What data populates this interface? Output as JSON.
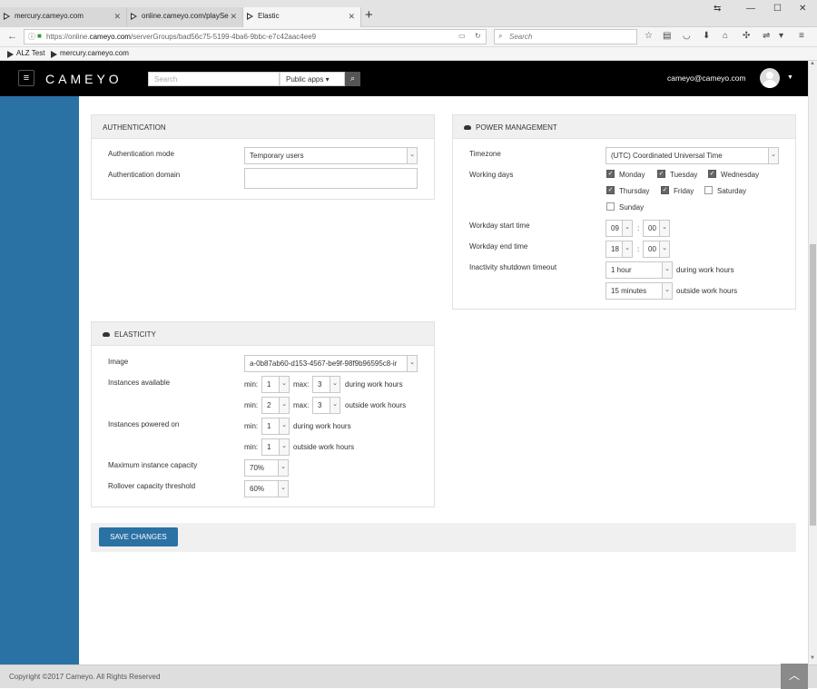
{
  "browser": {
    "tabs": [
      {
        "label": "mercury.cameyo.com",
        "active": false
      },
      {
        "label": "online.cameyo.com/playSe",
        "active": false
      },
      {
        "label": "Elastic",
        "active": true
      }
    ],
    "url_prefix": "https://online.",
    "url_domain": "cameyo.com",
    "url_path": "/serverGroups/bad56c75-5199-4ba6-9bbc-e7c42aac4ee9",
    "search_placeholder": "Search",
    "bookmarks": [
      "ALZ Test",
      "mercury.cameyo.com"
    ]
  },
  "header": {
    "logo": "CAMEYO",
    "search_placeholder": "Search",
    "scope_select": "Public apps",
    "user_email": "cameyo@cameyo.com"
  },
  "authentication": {
    "title": "AUTHENTICATION",
    "mode_label": "Authentication mode",
    "mode_value": "Temporary users",
    "domain_label": "Authentication domain",
    "domain_value": ""
  },
  "power": {
    "title": "POWER MANAGEMENT",
    "timezone_label": "Timezone",
    "timezone_value": "(UTC) Coordinated Universal Time",
    "working_days_label": "Working days",
    "days": [
      {
        "name": "Monday",
        "checked": true
      },
      {
        "name": "Tuesday",
        "checked": true
      },
      {
        "name": "Wednesday",
        "checked": true
      },
      {
        "name": "Thursday",
        "checked": true
      },
      {
        "name": "Friday",
        "checked": true
      },
      {
        "name": "Saturday",
        "checked": false
      },
      {
        "name": "Sunday",
        "checked": false
      }
    ],
    "start_label": "Workday start time",
    "start_hour": "09",
    "start_min": "00",
    "end_label": "Workday end time",
    "end_hour": "18",
    "end_min": "00",
    "time_sep": ":",
    "inactivity_label": "Inactivity shutdown timeout",
    "inactivity_work": "1 hour",
    "inactivity_work_suffix": "during work hours",
    "inactivity_off": "15 minutes",
    "inactivity_off_suffix": "outside work hours"
  },
  "elasticity": {
    "title": "ELASTICITY",
    "image_label": "Image",
    "image_value": "a-0b87ab60-d153-4567-be9f-98f9b96595c8-ir",
    "instances_label": "Instances available",
    "min_label": "min:",
    "max_label": "max:",
    "avail_work_min": "1",
    "avail_work_max": "3",
    "avail_work_suffix": "during work hours",
    "avail_off_min": "2",
    "avail_off_max": "3",
    "avail_off_suffix": "outside work hours",
    "powered_label": "Instances powered on",
    "powered_work_min": "1",
    "powered_work_suffix": "during work hours",
    "powered_off_min": "1",
    "powered_off_suffix": "outside work hours",
    "max_capacity_label": "Maximum instance capacity",
    "max_capacity_value": "70%",
    "rollover_label": "Rollover capacity threshold",
    "rollover_value": "60%"
  },
  "actions": {
    "save_label": "SAVE CHANGES"
  },
  "footer": {
    "copyright": "Copyright ©2017 Cameyo. All Rights Reserved"
  }
}
